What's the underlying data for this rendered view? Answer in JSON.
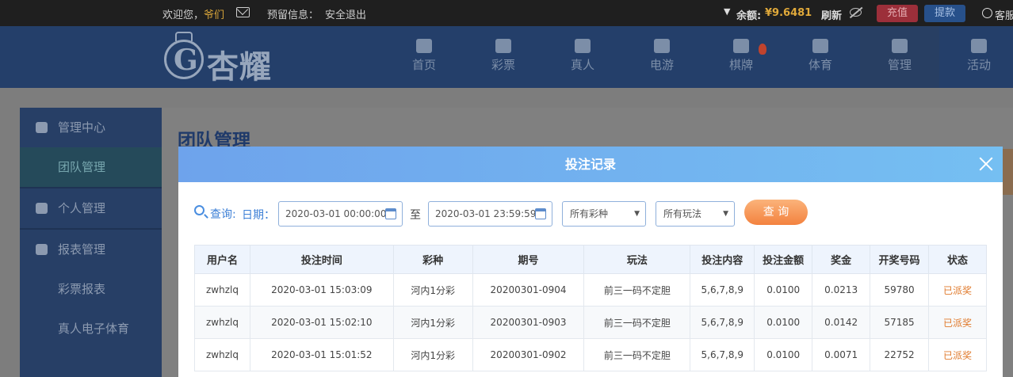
{
  "topbar": {
    "welcome_prefix": "欢迎您，",
    "username": "爷们",
    "reserved_info": "预留信息：",
    "logout": "安全退出",
    "balance_label": "余额:",
    "balance_value": "¥9.6481",
    "refresh": "刷新",
    "deposit": "充值",
    "withdraw": "提款",
    "customer_service": "客服"
  },
  "logo": {
    "text": "杏耀"
  },
  "nav": [
    {
      "label": "首页"
    },
    {
      "label": "彩票"
    },
    {
      "label": "真人"
    },
    {
      "label": "电游"
    },
    {
      "label": "棋牌"
    },
    {
      "label": "体育"
    },
    {
      "label": "管理"
    },
    {
      "label": "活动"
    }
  ],
  "sidebar": {
    "items": [
      {
        "label": "管理中心"
      },
      {
        "label": "团队管理"
      },
      {
        "label": "个人管理"
      },
      {
        "label": "报表管理"
      },
      {
        "label": "彩票报表"
      },
      {
        "label": "真人电子体育"
      }
    ]
  },
  "page": {
    "title": "团队管理"
  },
  "modal": {
    "title": "投注记录",
    "query_label": "查询:",
    "date_label": "日期：",
    "date_from": "2020-03-01 00:00:00",
    "to_label": "至",
    "date_to": "2020-03-01 23:59:59",
    "lottery_select": "所有彩种",
    "play_select": "所有玩法",
    "query_button": "查 询",
    "columns": [
      "用户名",
      "投注时间",
      "彩种",
      "期号",
      "玩法",
      "投注内容",
      "投注金额",
      "奖金",
      "开奖号码",
      "状态"
    ],
    "rows": [
      [
        "zwhzlq",
        "2020-03-01 15:03:09",
        "河内1分彩",
        "20200301-0904",
        "前三一码不定胆",
        "5,6,7,8,9",
        "0.0100",
        "0.0213",
        "59780",
        "已派奖"
      ],
      [
        "zwhzlq",
        "2020-03-01 15:02:10",
        "河内1分彩",
        "20200301-0903",
        "前三一码不定胆",
        "5,6,7,8,9",
        "0.0100",
        "0.0142",
        "57185",
        "已派奖"
      ],
      [
        "zwhzlq",
        "2020-03-01 15:01:52",
        "河内1分彩",
        "20200301-0902",
        "前三一码不定胆",
        "5,6,7,8,9",
        "0.0100",
        "0.0071",
        "22752",
        "已派奖"
      ]
    ]
  }
}
